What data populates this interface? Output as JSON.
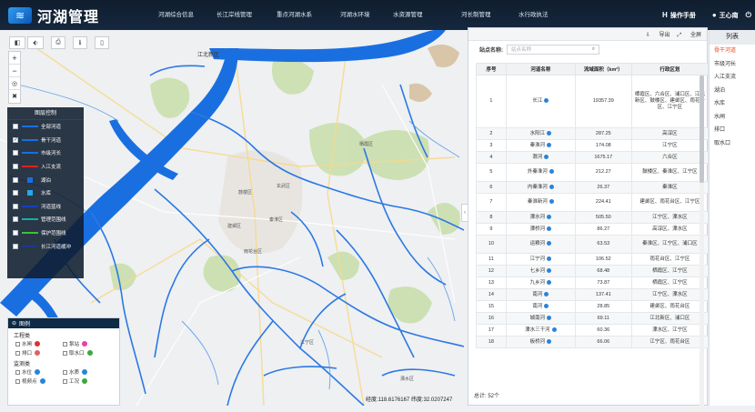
{
  "app": {
    "title": "河湖管理",
    "nav": [
      "河湖综合信息",
      "长江岸线管理",
      "重点河湖水系",
      "河湖水环境",
      "水资源管理",
      "河长制管理",
      "水行政执法"
    ],
    "manual_label": "操作手册",
    "user_name": "王心南"
  },
  "map": {
    "labels": [
      "江北新区",
      "鼓楼区",
      "玄武区",
      "秦淮区",
      "建邺区",
      "雨花台区",
      "江宁区",
      "溧水区",
      "栖霞区"
    ],
    "coords": "经度:118.6176167 纬度:32.0207247"
  },
  "layer_control": {
    "title": "图层控制",
    "items": [
      {
        "label": "全部河道",
        "checked": false,
        "symbol": "line",
        "color": "#1a6fe0"
      },
      {
        "label": "骨干河道",
        "checked": true,
        "symbol": "line",
        "color": "#1a6fe0"
      },
      {
        "label": "市级河长",
        "checked": false,
        "symbol": "line",
        "color": "#1a6fe0"
      },
      {
        "label": "入江支流",
        "checked": false,
        "symbol": "line",
        "color": "#e02020"
      },
      {
        "label": "湖泊",
        "checked": false,
        "symbol": "square",
        "color": "#1a6fe0"
      },
      {
        "label": "水库",
        "checked": false,
        "symbol": "square",
        "color": "#27a8e8"
      },
      {
        "label": "河道蓝线",
        "checked": false,
        "symbol": "line",
        "color": "#1540c0"
      },
      {
        "label": "管理范围线",
        "checked": false,
        "symbol": "line",
        "color": "#12b0a8"
      },
      {
        "label": "保护范围线",
        "checked": false,
        "symbol": "line",
        "color": "#3cc23c"
      },
      {
        "label": "长江河道缓冲",
        "checked": false,
        "symbol": "line",
        "color": "#1a3a8a"
      }
    ]
  },
  "legend": {
    "title": "图例",
    "sections": [
      {
        "name": "工程类",
        "items": [
          {
            "label": "水闸",
            "color": "#e03030"
          },
          {
            "label": "泵站",
            "color": "#e840a8"
          },
          {
            "label": "排口",
            "color": "#e06060"
          },
          {
            "label": "取水口",
            "color": "#3da83d"
          }
        ]
      },
      {
        "name": "监测类",
        "items": [
          {
            "label": "水位",
            "color": "#2a84d8"
          },
          {
            "label": "水质",
            "color": "#2a84d8"
          },
          {
            "label": "视频点",
            "color": "#2a84d8"
          },
          {
            "label": "工况",
            "color": "#3da83d"
          }
        ]
      }
    ]
  },
  "panel": {
    "export": "导出",
    "fullscreen": "全屏",
    "search_label": "站点名称:",
    "search_placeholder": "站点名称",
    "columns": [
      "序号",
      "河道名称",
      "流域面积（km²）",
      "行政区划"
    ],
    "rows": [
      {
        "no": "1",
        "name": "长江",
        "area": "19357.39",
        "district": "栖霞区、六合区、浦口区、江北新区、鼓楼区、建邺区、雨花台区、江宁区"
      },
      {
        "no": "2",
        "name": "水阳江",
        "area": "287.25",
        "district": "高淳区"
      },
      {
        "no": "3",
        "name": "秦淮河",
        "area": "174.08",
        "district": "江宁区"
      },
      {
        "no": "4",
        "name": "滁河",
        "area": "1675.17",
        "district": "六合区"
      },
      {
        "no": "5",
        "name": "外秦淮河",
        "area": "212.27",
        "district": "鼓楼区、秦淮区、江宁区"
      },
      {
        "no": "6",
        "name": "内秦淮河",
        "area": "26.37",
        "district": "秦淮区"
      },
      {
        "no": "7",
        "name": "秦淮新河",
        "area": "224.41",
        "district": "建邺区、雨花台区、江宁区"
      },
      {
        "no": "8",
        "name": "溧水河",
        "area": "505.50",
        "district": "江宁区、溧水区"
      },
      {
        "no": "9",
        "name": "溧桥河",
        "area": "86.27",
        "district": "高淳区、溧水区"
      },
      {
        "no": "10",
        "name": "运粮河",
        "area": "63.53",
        "district": "秦淮区、江宁区、浦口区"
      },
      {
        "no": "11",
        "name": "江宁河",
        "area": "106.52",
        "district": "雨花台区、江宁区"
      },
      {
        "no": "12",
        "name": "七乡河",
        "area": "68.48",
        "district": "栖霞区、江宁区"
      },
      {
        "no": "13",
        "name": "九乡河",
        "area": "73.87",
        "district": "栖霞区、江宁区"
      },
      {
        "no": "14",
        "name": "南河",
        "area": "137.41",
        "district": "江宁区、溧水区"
      },
      {
        "no": "15",
        "name": "南河",
        "area": "28.85",
        "district": "建邺区、雨花台区"
      },
      {
        "no": "16",
        "name": "城南河",
        "area": "69.11",
        "district": "江北新区、浦口区"
      },
      {
        "no": "17",
        "name": "溧水三干河",
        "area": "60.36",
        "district": "溧水区、江宁区"
      },
      {
        "no": "18",
        "name": "板桥河",
        "area": "66.06",
        "district": "江宁区、雨花台区"
      }
    ],
    "total": "总计: 52个"
  },
  "list": {
    "title": "列表",
    "items": [
      "骨干河道",
      "市级河长",
      "入江支流",
      "湖泊",
      "水库",
      "水闸",
      "排口",
      "取水口"
    ],
    "active_index": 0
  },
  "colors": {
    "header_bg": "#13233a",
    "river": "#1a6fe0",
    "active": "#e24c1d"
  }
}
